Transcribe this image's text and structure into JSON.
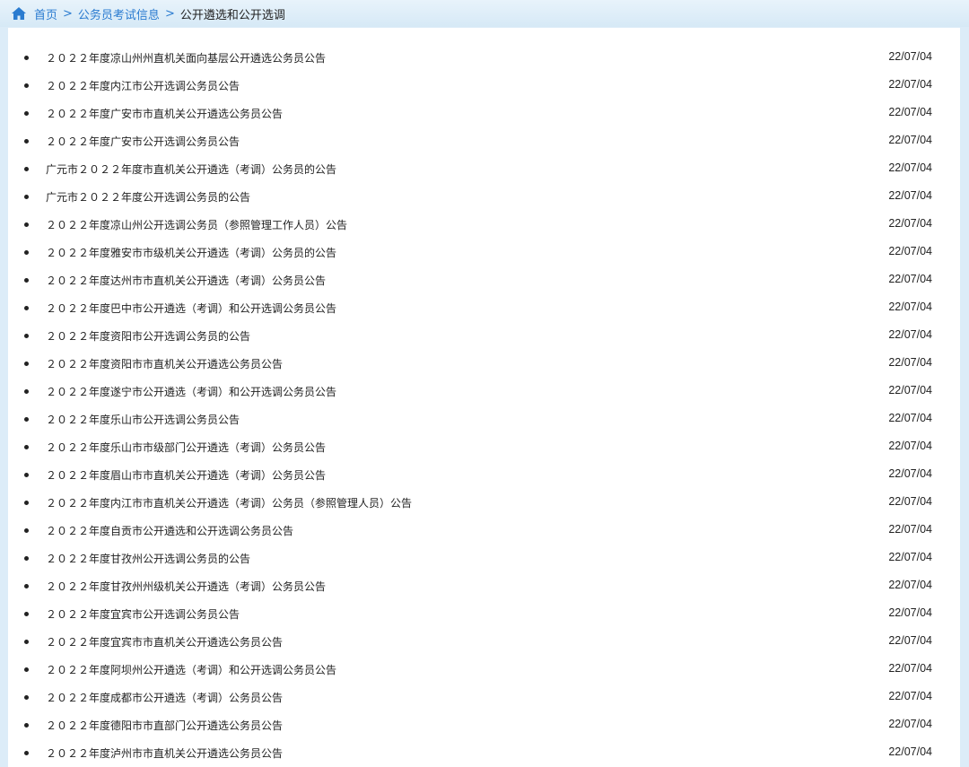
{
  "breadcrumb": {
    "home_icon": "home-icon",
    "home": "首页",
    "sep1": ">",
    "category": "公务员考试信息",
    "sep2": ">",
    "current": "公开遴选和公开选调"
  },
  "colors": {
    "link": "#2a7bd0",
    "header_bg": "#dcecf8",
    "panel_bg": "#ffffff",
    "text": "#222222"
  },
  "items": [
    {
      "title": "２０２２年度凉山州州直机关面向基层公开遴选公务员公告",
      "date": "22/07/04"
    },
    {
      "title": "２０２２年度内江市公开选调公务员公告",
      "date": "22/07/04"
    },
    {
      "title": "２０２２年度广安市市直机关公开遴选公务员公告",
      "date": "22/07/04"
    },
    {
      "title": "２０２２年度广安市公开选调公务员公告",
      "date": "22/07/04"
    },
    {
      "title": "广元市２０２２年度市直机关公开遴选（考调）公务员的公告",
      "date": "22/07/04"
    },
    {
      "title": "广元市２０２２年度公开选调公务员的公告",
      "date": "22/07/04"
    },
    {
      "title": "２０２２年度凉山州公开选调公务员（参照管理工作人员）公告",
      "date": "22/07/04"
    },
    {
      "title": "２０２２年度雅安市市级机关公开遴选（考调）公务员的公告",
      "date": "22/07/04"
    },
    {
      "title": "２０２２年度达州市市直机关公开遴选（考调）公务员公告",
      "date": "22/07/04"
    },
    {
      "title": "２０２２年度巴中市公开遴选（考调）和公开选调公务员公告",
      "date": "22/07/04"
    },
    {
      "title": "２０２２年度资阳市公开选调公务员的公告",
      "date": "22/07/04"
    },
    {
      "title": "２０２２年度资阳市市直机关公开遴选公务员公告",
      "date": "22/07/04"
    },
    {
      "title": "２０２２年度遂宁市公开遴选（考调）和公开选调公务员公告",
      "date": "22/07/04"
    },
    {
      "title": "２０２２年度乐山市公开选调公务员公告",
      "date": "22/07/04"
    },
    {
      "title": "２０２２年度乐山市市级部门公开遴选（考调）公务员公告",
      "date": "22/07/04"
    },
    {
      "title": "２０２２年度眉山市市直机关公开遴选（考调）公务员公告",
      "date": "22/07/04"
    },
    {
      "title": "２０２２年度内江市市直机关公开遴选（考调）公务员（参照管理人员）公告",
      "date": "22/07/04"
    },
    {
      "title": "２０２２年度自贡市公开遴选和公开选调公务员公告",
      "date": "22/07/04"
    },
    {
      "title": "２０２２年度甘孜州公开选调公务员的公告",
      "date": "22/07/04"
    },
    {
      "title": "２０２２年度甘孜州州级机关公开遴选（考调）公务员公告",
      "date": "22/07/04"
    },
    {
      "title": "２０２２年度宜宾市公开选调公务员公告",
      "date": "22/07/04"
    },
    {
      "title": "２０２２年度宜宾市市直机关公开遴选公务员公告",
      "date": "22/07/04"
    },
    {
      "title": "２０２２年度阿坝州公开遴选（考调）和公开选调公务员公告",
      "date": "22/07/04"
    },
    {
      "title": "２０２２年度成都市公开遴选（考调）公务员公告",
      "date": "22/07/04"
    },
    {
      "title": "２０２２年度德阳市市直部门公开遴选公务员公告",
      "date": "22/07/04"
    },
    {
      "title": "２０２２年度泸州市市直机关公开遴选公务员公告",
      "date": "22/07/04"
    }
  ]
}
